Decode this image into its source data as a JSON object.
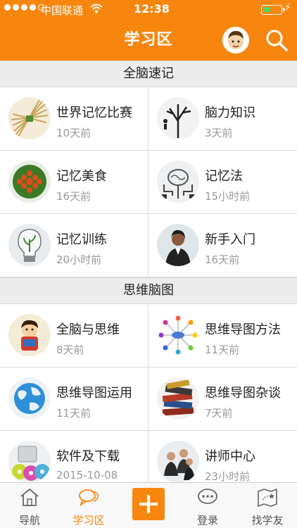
{
  "status_bar": {
    "carrier": "中国联通",
    "time": "12:38",
    "signal_filled": 4,
    "signal_total": 5
  },
  "header": {
    "title": "学习区"
  },
  "sections": [
    {
      "title": "全脑速记",
      "items": [
        {
          "title": "世界记忆比赛",
          "time": "10天前",
          "icon": "wheat-bundle"
        },
        {
          "title": "脑力知识",
          "time": "3天前",
          "icon": "tree-silhouette"
        },
        {
          "title": "记忆美食",
          "time": "16天前",
          "icon": "tomato-plate"
        },
        {
          "title": "记忆法",
          "time": "15小时前",
          "icon": "brain-circuit"
        },
        {
          "title": "记忆训练",
          "time": "20小时前",
          "icon": "lightbulb-plant"
        },
        {
          "title": "新手入门",
          "time": "16天前",
          "icon": "businesswoman"
        }
      ]
    },
    {
      "title": "思维脑图",
      "items": [
        {
          "title": "全脑与思维",
          "time": "8天前",
          "icon": "cartoon-kid"
        },
        {
          "title": "思维导图方法",
          "time": "11天前",
          "icon": "mind-map"
        },
        {
          "title": "思维导图运用",
          "time": "11天前",
          "icon": "globe"
        },
        {
          "title": "思维导图杂谈",
          "time": "7天前",
          "icon": "book-stack"
        },
        {
          "title": "软件及下载",
          "time": "2015-10-08",
          "icon": "software-discs"
        },
        {
          "title": "讲师中心",
          "time": "23小时前",
          "icon": "lecturers"
        }
      ]
    }
  ],
  "tabbar": [
    {
      "label": "导航",
      "icon": "home-icon",
      "active": false
    },
    {
      "label": "学习区",
      "icon": "chat-icon",
      "active": true
    },
    {
      "label": "",
      "icon": "plus-icon",
      "active": false
    },
    {
      "label": "登录",
      "icon": "speech-dots-icon",
      "active": false
    },
    {
      "label": "找学友",
      "icon": "map-icon",
      "active": false
    }
  ],
  "colors": {
    "accent": "#f7860f",
    "section_bg": "#ececec",
    "muted_text": "#999999"
  }
}
